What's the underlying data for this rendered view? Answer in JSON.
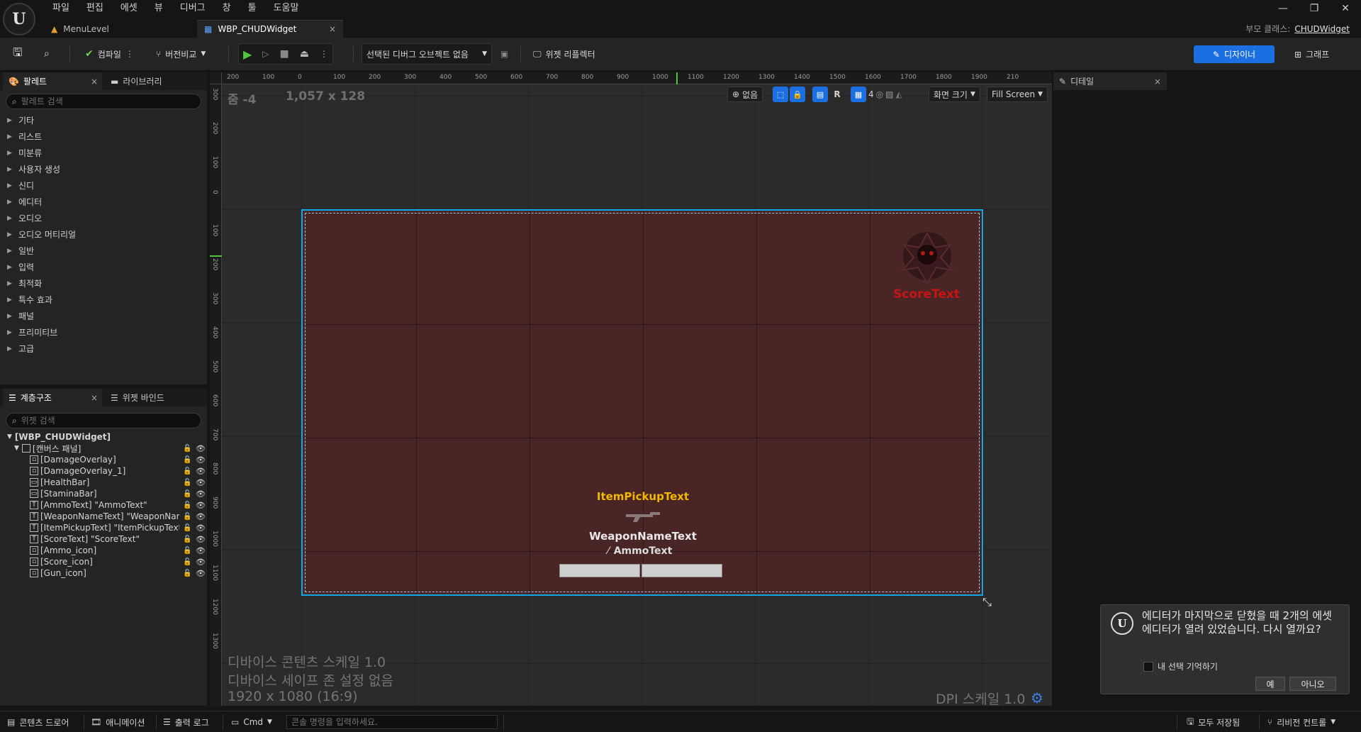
{
  "menu": [
    "파일",
    "편집",
    "에셋",
    "뷰",
    "디버그",
    "창",
    "툴",
    "도움말"
  ],
  "tabs": [
    {
      "label": "MenuLevel"
    },
    {
      "label": "WBP_CHUDWidget",
      "close": "×"
    }
  ],
  "parent_class": {
    "label": "부모 클래스:",
    "value": "CHUDWidget"
  },
  "window_controls": [
    "—",
    "❐",
    "✕"
  ],
  "toolbar": {
    "compile": "컴파일",
    "diff": "버전비교",
    "debug_object": "선택된 디버그 오브젝트 없음",
    "widget_reflector": "위젯 리플렉터",
    "designer": "디자이너",
    "graph": "그래프"
  },
  "palette": {
    "tab_palette": "팔레트",
    "tab_library": "라이브러리",
    "close": "×",
    "search_placeholder": "팔레트 검색",
    "categories": [
      "기타",
      "리스트",
      "미분류",
      "사용자 생성",
      "신디",
      "에디터",
      "오디오",
      "오디오 머티리얼",
      "일반",
      "입력",
      "최적화",
      "특수 효과",
      "패널",
      "프리미티브",
      "고급"
    ]
  },
  "hierarchy": {
    "tab_hierarchy": "계층구조",
    "tab_bindings": "위젯 바인드",
    "close": "×",
    "search_placeholder": "위젯 검색",
    "root": "[WBP_CHUDWidget]",
    "canvas": "[캔버스 패널]",
    "items": [
      {
        "label": "[DamageOverlay]",
        "icon": "image-icon"
      },
      {
        "label": "[DamageOverlay_1]",
        "icon": "image-icon"
      },
      {
        "label": "[HealthBar]",
        "icon": "progressbar-icon"
      },
      {
        "label": "[StaminaBar]",
        "icon": "progressbar-icon"
      },
      {
        "label": "[AmmoText] \"AmmoText\"",
        "icon": "text-icon"
      },
      {
        "label": "[WeaponNameText] \"WeaponNameText\"",
        "icon": "text-icon"
      },
      {
        "label": "[ItemPickupText] \"ItemPickupText\"",
        "icon": "text-icon"
      },
      {
        "label": "[ScoreText] \"ScoreText\"",
        "icon": "text-icon"
      },
      {
        "label": "[Ammo_icon]",
        "icon": "image-icon"
      },
      {
        "label": "[Score_icon]",
        "icon": "image-icon"
      },
      {
        "label": "[Gun_icon]",
        "icon": "image-icon"
      }
    ]
  },
  "viewport": {
    "zoom": "줌 -4",
    "size": "1,057 x 128",
    "ruler_top": [
      "200",
      "100",
      "0",
      "100",
      "200",
      "300",
      "400",
      "500",
      "600",
      "700",
      "800",
      "900",
      "1000",
      "1100",
      "1200",
      "1300",
      "1400",
      "1500",
      "1600",
      "1700",
      "1800",
      "1900",
      "210"
    ],
    "ruler_left": [
      "300",
      "200",
      "100",
      "0",
      "100",
      "200",
      "300",
      "400",
      "500",
      "600",
      "700",
      "800",
      "900",
      "1000",
      "1100",
      "1200",
      "1300"
    ],
    "locale": "없음",
    "r_button": "R",
    "grid_snap": "4",
    "screen_size": "화면 크기",
    "fill_mode": "Fill Screen",
    "device_scale": "디바이스 콘텐츠 스케일 1.0",
    "safe_zone": "디바이스 세이프 존 설정 없음",
    "resolution": "1920 x 1080 (16:9)",
    "dpi": "DPI 스케일 1.0",
    "widgets": {
      "score_text": "ScoreText",
      "item_pickup_text": "ItemPickupText",
      "weapon_name_text": "WeaponNameText",
      "ammo_text": "AmmoText"
    },
    "colors": {
      "score": "#c81414",
      "pickup": "#f0b800",
      "frame": "#0fa7e8",
      "canvas_bg": "#4a2525"
    }
  },
  "details": {
    "title": "디테일",
    "close": "×"
  },
  "toast": {
    "message": "에디터가 마지막으로 닫혔을 때 2개의 에셋 에디터가 열려 있었습니다. 다시 열까요?",
    "remember": "내 선택 기억하기",
    "yes": "예",
    "no": "아니오"
  },
  "statusbar": {
    "content_drawer": "콘텐츠 드로어",
    "animation": "애니메이션",
    "output_log": "출력 로그",
    "cmd": "Cmd",
    "console_placeholder": "콘솔 명령을 입력하세요.",
    "save_all": "모두 저장됨",
    "revision_control": "리비전 컨트롤"
  }
}
